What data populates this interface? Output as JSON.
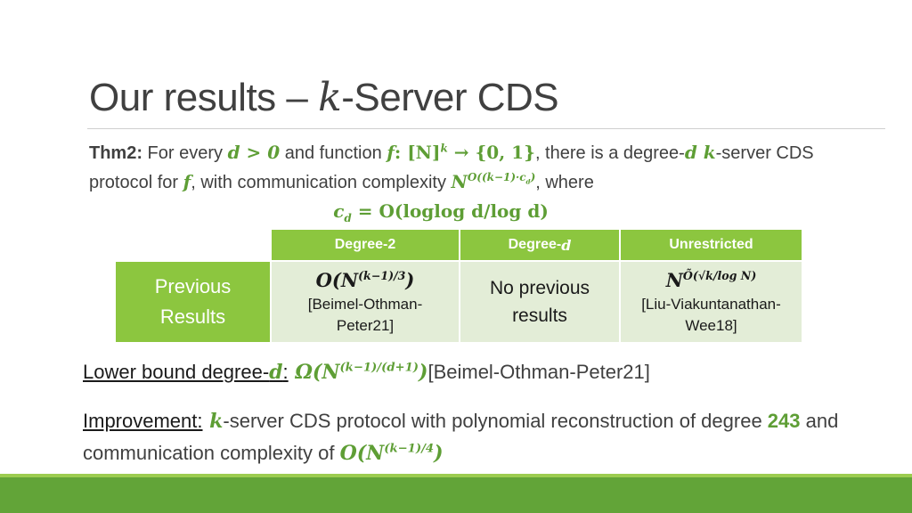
{
  "slide": {
    "title_prefix": "Our results – ",
    "title_k": "k",
    "title_suffix": "-Server CDS"
  },
  "theorem": {
    "label": "Thm2:",
    "t1": " For every ",
    "m_d_gt_0": "d  >  0",
    "t2": " and function ",
    "m_f": "f",
    "m_map": ": [N]",
    "m_k": "k",
    "m_arrow_set": " → {0, 1}",
    "t3": ", there is a degree-",
    "m_d": "d",
    "m_k2": " k",
    "t4": "-server CDS protocol for ",
    "m_f2": "f",
    "t5": ", with communication complexity ",
    "m_N": "N",
    "m_exp": "O((k−1)·c",
    "m_exp_sub": "d",
    "m_exp_close": ")",
    "t6": ", where",
    "m_cd": "c",
    "m_cd_sub": "d",
    "m_cd_def": " = O(loglog d/log d)"
  },
  "table": {
    "headers": [
      "Degree-2",
      "Degree-",
      "Unrestricted"
    ],
    "header_degree_var": "d",
    "row_label_line1": "Previous",
    "row_label_line2": "Results",
    "cells": {
      "degree2_formula_pre": "O(N",
      "degree2_formula_exp": "(k−1)/3",
      "degree2_formula_post": ")",
      "degree2_cite_line1": "[Beimel-Othman-",
      "degree2_cite_line2": "Peter21]",
      "degreed_line1": "No previous",
      "degreed_line2": "results",
      "unres_formula_base": "N",
      "unres_formula_exp": "Õ(√k/log N)",
      "unres_cite_line1": "[Liu-Viakuntanathan-",
      "unres_cite_line2": "Wee18]"
    }
  },
  "lower_bound": {
    "label": "Lower bound degree-",
    "m_d": "d",
    "colon": ":",
    "m_formula_pre": " Ω(N",
    "m_formula_exp": "(k−1)/(d+1)",
    "m_formula_post": ")",
    "cite": "[Beimel-Othman-Peter21]"
  },
  "improvement": {
    "label": "Improvement:",
    "m_k": " k",
    "t1": "-server CDS protocol with polynomial reconstruction of degree ",
    "degree": "243",
    "t2": " and communication complexity of ",
    "m_formula_pre": "O(N",
    "m_formula_exp": "(k−1)/4",
    "m_formula_post": ")"
  },
  "colors": {
    "accent_green": "#5e9e35",
    "table_header_green": "#8cc63f",
    "table_cell_bg": "#e3edd7",
    "footer_dark_green": "#62a438"
  }
}
